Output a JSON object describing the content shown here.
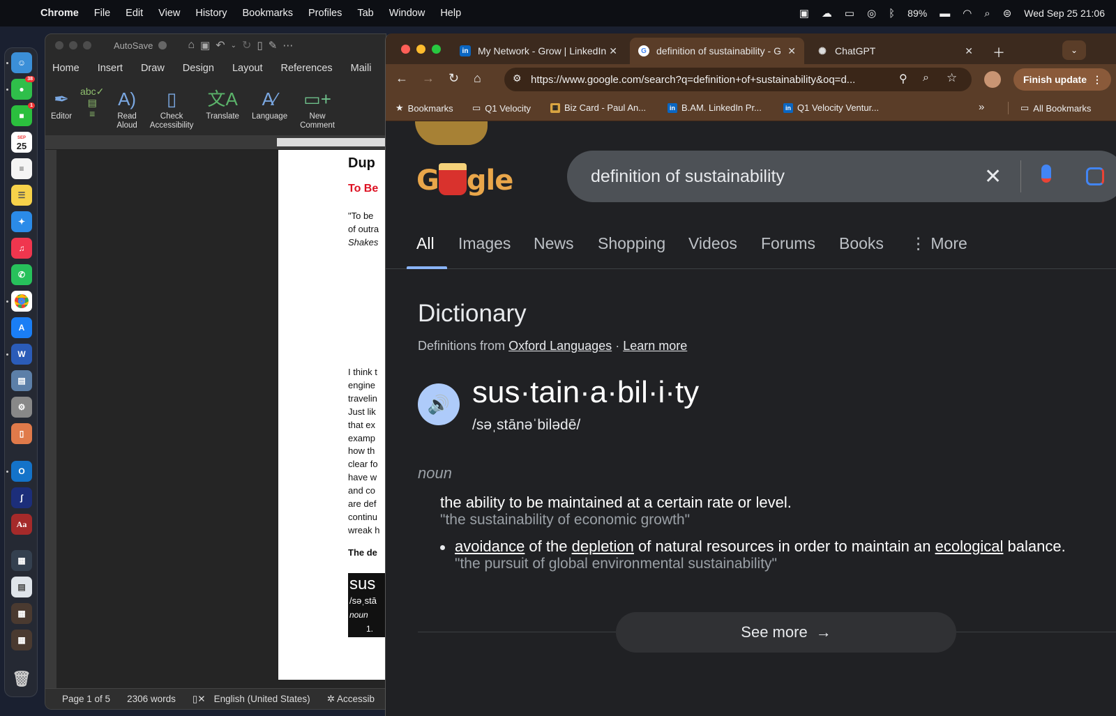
{
  "menubar": {
    "app": "Chrome",
    "items": [
      "File",
      "Edit",
      "View",
      "History",
      "Bookmarks",
      "Profiles",
      "Tab",
      "Window",
      "Help"
    ],
    "battery": "89%",
    "datetime": "Wed Sep 25  21:06"
  },
  "dock": {
    "calendar_day": "25",
    "calendar_month": "SEP",
    "messages_badge": "38",
    "facetime_badge": "1",
    "dictionary_label": "Aa"
  },
  "word": {
    "autosave_label": "AutoSave",
    "tabs": [
      "Home",
      "Insert",
      "Draw",
      "Design",
      "Layout",
      "References",
      "Maili"
    ],
    "ribbon": [
      {
        "label": "Editor"
      },
      {
        "label": "Read\nAloud"
      },
      {
        "label": "Check\nAccessibility"
      },
      {
        "label": "Translate"
      },
      {
        "label": "Language"
      },
      {
        "label": "New\nComment"
      }
    ],
    "page_fragments": {
      "heading": "Dup",
      "subheading": "To Be",
      "quote1": "\"To be",
      "quote2": "of outra",
      "quote3": "Shakes",
      "body": [
        "I think t",
        "engine",
        "travelin",
        "Just lik",
        "that ex",
        "examp",
        "how th",
        "clear fo",
        "have w",
        "and co",
        "are def",
        "continu",
        "wreak h"
      ],
      "bold_line": "The de",
      "snippet_word": "sus",
      "snippet_phon": "/səˌstā",
      "snippet_pos": "noun",
      "snippet_num": "1."
    },
    "status": {
      "page": "Page 1 of 5",
      "words": "2306 words",
      "language": "English (United States)",
      "accessibility": "Accessib"
    }
  },
  "chrome": {
    "tabs": [
      {
        "title": "My Network - Grow | LinkedIn"
      },
      {
        "title": "definition of sustainability - G"
      },
      {
        "title": "ChatGPT"
      }
    ],
    "url": "https://www.google.com/search?q=definition+of+sustainability&oq=d...",
    "finish_update": "Finish update",
    "bookmarks": [
      {
        "label": "Bookmarks"
      },
      {
        "label": "Q1 Velocity"
      },
      {
        "label": "Biz Card - Paul An..."
      },
      {
        "label": "B.AM. LinkedIn Pr..."
      },
      {
        "label": "Q1 Velocity Ventur..."
      }
    ],
    "all_bookmarks": "All Bookmarks"
  },
  "google": {
    "logo_left": "G",
    "logo_right": "gle",
    "query": "definition of sustainability",
    "tabs": [
      "All",
      "Images",
      "News",
      "Shopping",
      "Videos",
      "Forums",
      "Books",
      "More"
    ],
    "active_tab": "All",
    "dictionary": {
      "title": "Dictionary",
      "source_prefix": "Definitions from",
      "source_link": "Oxford Languages",
      "separator": "·",
      "learn_more": "Learn more",
      "word": "sus·tain·a·bil·i·ty",
      "phonetic": "/səˌstānəˈbilədē/",
      "part_of_speech": "noun",
      "definition1": "the ability to be maintained at a certain rate or level.",
      "example1": "\"the sustainability of economic growth\"",
      "definition2_parts": [
        "avoidance",
        " of the ",
        "depletion",
        " of natural resources in order to maintain an ",
        "ecological",
        " balance."
      ],
      "example2": "\"the pursuit of global environmental sustainability\"",
      "see_more": "See more"
    }
  }
}
